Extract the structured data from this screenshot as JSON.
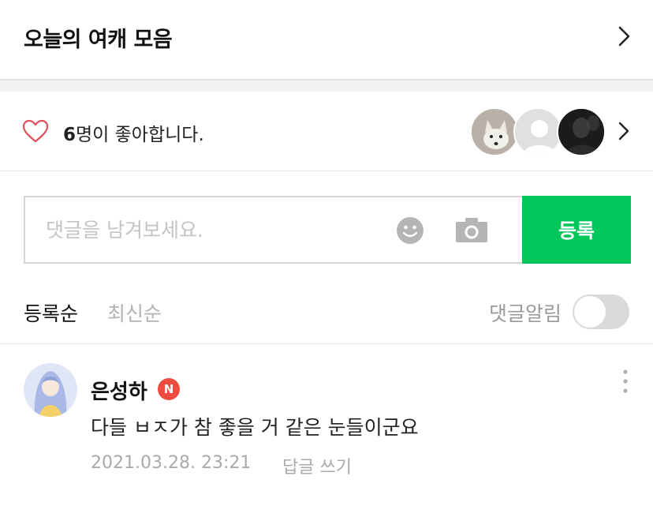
{
  "header": {
    "title": "오늘의 여캐 모음"
  },
  "likes": {
    "count": "6",
    "text": "명이 좋아합니다."
  },
  "comment_form": {
    "placeholder": "댓글을 남겨보세요.",
    "submit_label": "등록"
  },
  "sort": {
    "tabs": [
      {
        "label": "등록순",
        "active": true
      },
      {
        "label": "최신순",
        "active": false
      }
    ],
    "notify_label": "댓글알림",
    "notify_enabled": false
  },
  "comments": [
    {
      "author": "은성하",
      "badge": "N",
      "body": "다들 ㅂㅈ가 참 좋을 거 같은 눈들이군요",
      "date": "2021.03.28. 23:21",
      "reply_label": "답글 쓰기"
    }
  ],
  "colors": {
    "accent": "#03c75a",
    "heart": "#e0505a",
    "badge": "#ef4b3f"
  }
}
